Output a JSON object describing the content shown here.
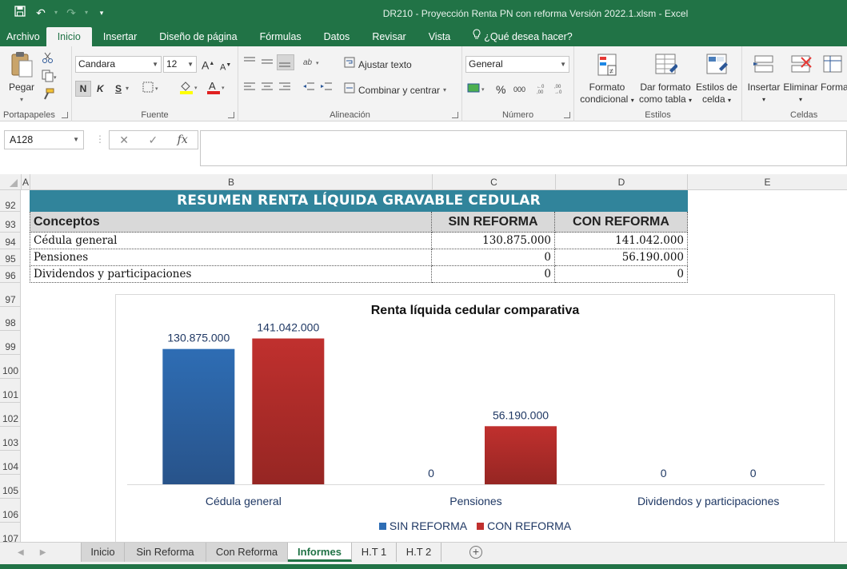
{
  "window": {
    "title": "DR210 - Proyección Renta PN con reforma Versión 2022.1.xlsm  -  Excel"
  },
  "ribbon_tabs": [
    "Archivo",
    "Inicio",
    "Insertar",
    "Diseño de página",
    "Fórmulas",
    "Datos",
    "Revisar",
    "Vista"
  ],
  "help_label": "¿Qué desea hacer?",
  "ribbon": {
    "portapapeles": {
      "label": "Portapapeles",
      "paste_label": "Pegar"
    },
    "fuente": {
      "label": "Fuente",
      "font_name": "Candara",
      "font_size": "12",
      "bold": "N",
      "italic": "K",
      "underline": "S"
    },
    "alineacion": {
      "label": "Alineación",
      "wrap_label": "Ajustar texto",
      "merge_label": "Combinar y centrar"
    },
    "numero": {
      "label": "Número",
      "format": "General",
      "percent": "%",
      "thousands": "000"
    },
    "estilos": {
      "label": "Estilos",
      "cond_format_1": "Formato",
      "cond_format_2": "condicional",
      "table_format_1": "Dar formato",
      "table_format_2": "como tabla",
      "cell_styles_1": "Estilos de",
      "cell_styles_2": "celda"
    },
    "celdas": {
      "label": "Celdas",
      "insert": "Insertar",
      "delete": "Eliminar",
      "format": "Forma"
    }
  },
  "formula_bar": {
    "name_box": "A128",
    "fx": "fx",
    "value": ""
  },
  "columns": [
    "A",
    "B",
    "C",
    "D",
    "E"
  ],
  "rows": [
    "92",
    "93",
    "94",
    "95",
    "96",
    "97",
    "98",
    "99",
    "100",
    "101",
    "102",
    "103",
    "104",
    "105",
    "106",
    "107"
  ],
  "table": {
    "title": "RESUMEN RENTA LÍQUIDA GRAVABLE CEDULAR",
    "headers": [
      "Conceptos",
      "SIN REFORMA",
      "CON REFORMA"
    ],
    "rows": [
      [
        "Cédula general",
        "130.875.000",
        "141.042.000"
      ],
      [
        "Pensiones",
        "0",
        "56.190.000"
      ],
      [
        "Dividendos y participaciones",
        "0",
        "0"
      ]
    ]
  },
  "chart_data": {
    "type": "bar",
    "title": "Renta líquida cedular comparativa",
    "categories": [
      "Cédula general",
      "Pensiones",
      "Dividendos y participaciones"
    ],
    "series": [
      {
        "name": "SIN REFORMA",
        "values": [
          130875000,
          0,
          0
        ],
        "labels": [
          "130.875.000",
          "0",
          "0"
        ],
        "color": "#2e6db4"
      },
      {
        "name": "CON REFORMA",
        "values": [
          141042000,
          56190000,
          0
        ],
        "labels": [
          "141.042.000",
          "56.190.000",
          "0"
        ],
        "color": "#c0302e"
      }
    ],
    "ylim": [
      0,
      160000000
    ],
    "legend": "bottom",
    "grid": false
  },
  "sheets": [
    "Inicio",
    "Sin Reforma",
    "Con Reforma",
    "Informes",
    "H.T 1",
    "H.T 2"
  ],
  "active_sheet": "Informes",
  "colors": {
    "excel_green": "#217346",
    "band": "#31849b"
  }
}
